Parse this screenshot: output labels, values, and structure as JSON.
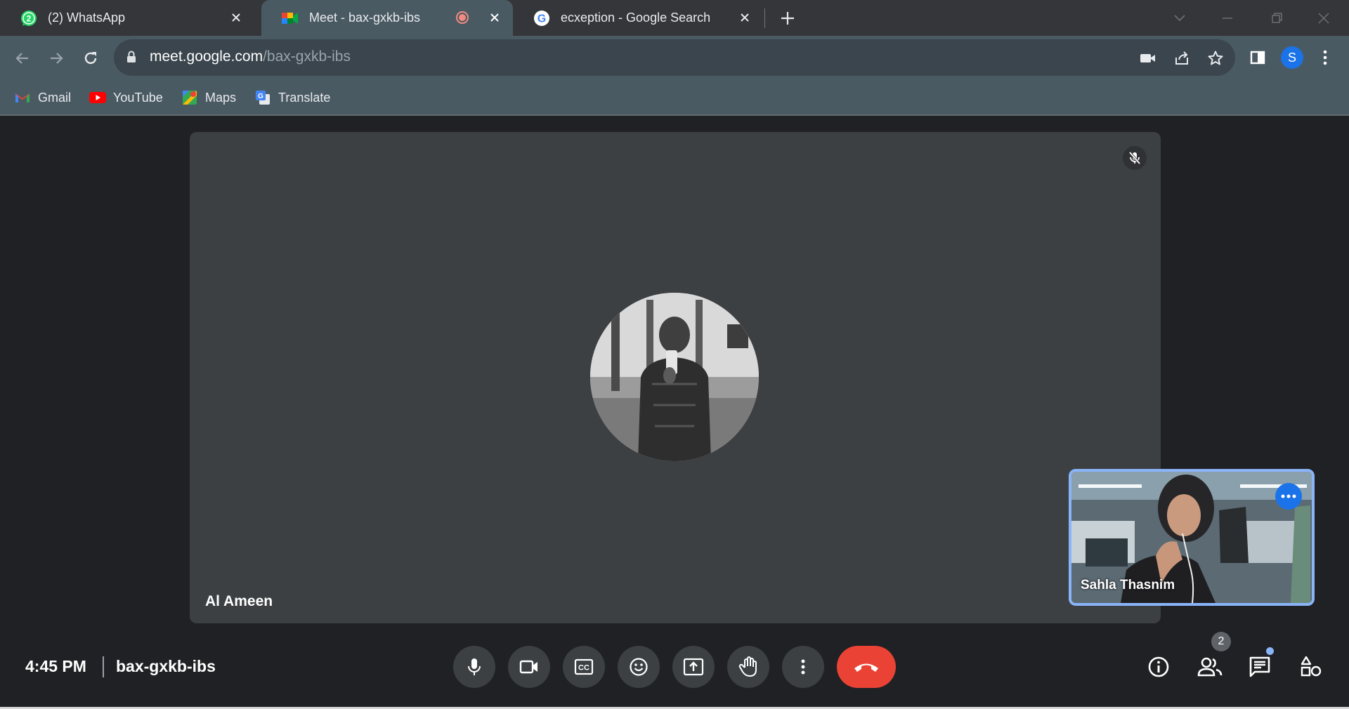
{
  "tabs": [
    {
      "title": "(2) WhatsApp",
      "badge": "2"
    },
    {
      "title": "Meet - bax-gxkb-ibs"
    },
    {
      "title": "ecxeption - Google Search"
    }
  ],
  "address": {
    "host": "meet.google.com",
    "path": "/bax-gxkb-ibs"
  },
  "profile_initial": "S",
  "bookmarks": [
    "Gmail",
    "YouTube",
    "Maps",
    "Translate"
  ],
  "meeting": {
    "main_participant": "Al Ameen",
    "self_participant": "Sahla Thasnim",
    "time": "4:45 PM",
    "code": "bax-gxkb-ibs",
    "people_count": "2"
  },
  "colors": {
    "accent": "#8ab4f8",
    "end_call": "#ea4335",
    "brand_blue": "#1a73e8"
  }
}
